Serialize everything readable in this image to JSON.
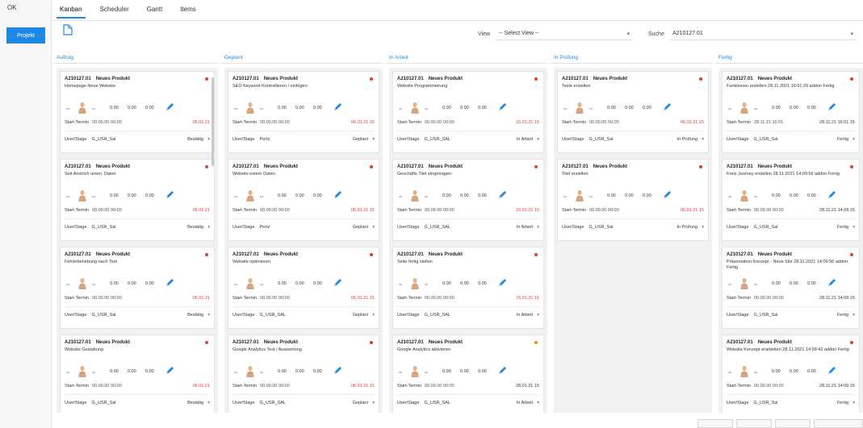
{
  "leftbar": {
    "ok": "OK",
    "project": "Projekt"
  },
  "tabs": [
    {
      "label": "Kanban",
      "active": true
    },
    {
      "label": "Scheduler",
      "active": false
    },
    {
      "label": "Gantt",
      "active": false
    },
    {
      "label": "Items",
      "active": false
    }
  ],
  "toolbar": {
    "view_label": "View",
    "view_value": "-- Select View --",
    "search_label": "Suche",
    "search_value": "A210127.01"
  },
  "columns": [
    {
      "title": "Auftrag",
      "cards": [
        {
          "id": "A210127.01",
          "type": "Neues Produkt",
          "title": "Homepage Neue Website",
          "icon1": "rate",
          "icon2": "time",
          "v1": "0.00",
          "v2": "0.00",
          "v3": "0.00",
          "start_label": "Start-Termin",
          "start": "00.00.00 00:00",
          "due": "06.01.21",
          "user_label": "User/Stage",
          "user": "G_USR_Sal",
          "stage": "Bestätig"
        },
        {
          "id": "A210127.01",
          "type": "Neues Produkt",
          "title": "Seit Anstrich unten, Daten",
          "icon1": "rate",
          "icon2": "time",
          "v1": "0.00",
          "v2": "0.00",
          "v3": "0.00",
          "start_label": "Start-Termin",
          "start": "00.00.00 00:00",
          "due": "06.01.21",
          "user_label": "User/Stage",
          "user": "G_USR_Sal",
          "stage": "Bestätig"
        },
        {
          "id": "A210127.01",
          "type": "Neues Produkt",
          "title": "Fehlerbehebung nach Test",
          "icon1": "rate",
          "icon2": "time",
          "v1": "0.00",
          "v2": "0.00",
          "v3": "0.00",
          "start_label": "Start-Termin",
          "start": "00.00.00 00:00",
          "due": "06.01.21",
          "user_label": "User/Stage",
          "user": "G_USR_Sal",
          "stage": "Bestätig"
        },
        {
          "id": "A210127.01",
          "type": "Neues Produkt",
          "title": "Website Gestaltung",
          "icon1": "rate",
          "icon2": "time",
          "v1": "0.00",
          "v2": "0.00",
          "v3": "0.00",
          "start_label": "Start-Termin",
          "start": "00.00.00 00:00",
          "due": "06.01.21",
          "user_label": "User/Stage",
          "user": "G_USR_Sal",
          "stage": "Bestätig"
        }
      ]
    },
    {
      "title": "Geplant",
      "cards": [
        {
          "id": "A210127.01",
          "type": "Neues Produkt",
          "title": "SEO Keyword Kontrollieren / einfügen",
          "icon1": "rate",
          "icon2": "time",
          "v1": "0.00",
          "v2": "0.00",
          "v3": "0.00",
          "start_label": "Start-Termin",
          "start": "00.00.00 00:00",
          "due": "06.01.21 15",
          "user_label": "User/Stage",
          "user": "Pertz",
          "stage": "Geplant"
        },
        {
          "id": "A210127.01",
          "type": "Neues Produkt",
          "title": "Website extern Daten",
          "icon1": "rate",
          "icon2": "time",
          "v1": "0.00",
          "v2": "0.00",
          "v3": "0.00",
          "start_label": "Start-Termin",
          "start": "00.00.00 00:00",
          "due": "06.01.21 15",
          "user_label": "User/Stage",
          "user": "Pertz",
          "stage": "Geplant"
        },
        {
          "id": "A210127.01",
          "type": "Neues Produkt",
          "title": "Website optimieren",
          "icon1": "rate",
          "icon2": "time",
          "v1": "0.00",
          "v2": "0.00",
          "v3": "0.00",
          "start_label": "Start-Termin",
          "start": "00.00.00 00:00",
          "due": "06.01.21 15",
          "user_label": "User/Stage",
          "user": "G_USR_SAL",
          "stage": "Geplant"
        },
        {
          "id": "A210127.01",
          "type": "Neues Produkt",
          "title": "Google Analytics Test / Auswertung",
          "icon1": "rate",
          "icon2": "time",
          "v1": "0.00",
          "v2": "0.00",
          "v3": "0.00",
          "start_label": "Start-Termin",
          "start": "00.00.00 00:00",
          "due": "06.01.21 15",
          "user_label": "User/Stage",
          "user": "G_USR_SAL",
          "stage": "Geplant"
        }
      ]
    },
    {
      "title": "In Arbeit",
      "cards": [
        {
          "id": "A210127.01",
          "type": "Neues Produkt",
          "title": "Website Programmierung",
          "icon1": "rate",
          "icon2": "time",
          "v1": "0.00",
          "v2": "0.00",
          "v3": "0.00",
          "start_label": "Start-Termin",
          "start": "00.00.00 00:00",
          "due": "15.01.21 15",
          "user_label": "User/Stage",
          "user": "G_USR_SAL",
          "stage": "In Arbeit"
        },
        {
          "id": "A210127.01",
          "type": "Neues Produkt",
          "title": "Geschäfts Titel eingetragen",
          "icon1": "rate",
          "icon2": "time",
          "v1": "0.00",
          "v2": "0.00",
          "v3": "0.00",
          "start_label": "Start-Termin",
          "start": "00.00.00 00:00",
          "due": "15.01.21 15",
          "user_label": "User/Stage",
          "user": "G_USR_SAL",
          "stage": "In Arbeit"
        },
        {
          "id": "A210127.01",
          "type": "Neues Produkt",
          "title": "Seite fertig stellen",
          "icon1": "rate",
          "icon2": "time",
          "v1": "0.00",
          "v2": "0.00",
          "v3": "0.00",
          "start_label": "Start-Termin",
          "start": "00.00.00 00:00",
          "due": "15.01.21 15",
          "user_label": "User/Stage",
          "user": "G_USR_SAL",
          "stage": "In Arbeit"
        },
        {
          "id": "A210127.01",
          "type": "Neues Produkt",
          "title": "Google Analytics aktivieren",
          "icon1": "rate",
          "icon2": "time",
          "v1": "0.00",
          "v2": "0.00",
          "v3": "0.00",
          "start_label": "Start-Termin",
          "start": "00.00.00 00:00",
          "due": "28.01.21 15",
          "due_black": true,
          "dot": "orange",
          "user_label": "User/Stage",
          "user": "G_USR_SAL",
          "stage": "In Arbeit"
        }
      ]
    },
    {
      "title": "In Prüfung",
      "cards": [
        {
          "id": "A210127.01",
          "type": "Neues Produkt",
          "title": "Texte erstellen",
          "icon1": "rate",
          "icon2": "time",
          "v1": "0.00",
          "v2": "0.00",
          "v3": "0.00",
          "start_label": "Start-Termin",
          "start": "00.00.00 00:00",
          "due": "06.01.21 15",
          "user_label": "User/Stage",
          "user": "G_USR_Sal",
          "stage": "In Prüfung"
        },
        {
          "id": "A210127.01",
          "type": "Neues Produkt",
          "title": "Titel erstellen",
          "icon1": "rate",
          "icon2": "time",
          "v1": "0.00",
          "v2": "0.00",
          "v3": "0.00",
          "start_label": "Start-Termin",
          "start": "00.00.00 00:00",
          "due": "06.01.21 15",
          "user_label": "User/Stage",
          "user": "G_USR_Sal",
          "stage": "In Prüfung"
        }
      ]
    },
    {
      "title": "Fertig",
      "cards": [
        {
          "id": "A210127.01",
          "type": "Neues Produkt",
          "title": "Funktionen erstellen 28.11.2021 16:01:29 addon Fertig",
          "icon1": "rate",
          "icon2": "time",
          "v1": "0.00",
          "v2": "0.00",
          "v3": "0.00",
          "start_label": "Start-Termin",
          "start": "28.11.21 16:01",
          "due": "28.11.21 16:01 15",
          "due_black": true,
          "user_label": "User/Stage",
          "user": "G_USR_Sal",
          "stage": "Fertig"
        },
        {
          "id": "A210127.01",
          "type": "Neues Produkt",
          "title": "Kreis Journey erstellen 28.11.2021 14:09:56 addon Fertig",
          "icon1": "rate",
          "icon2": "time",
          "v1": "0.00",
          "v2": "0.00",
          "v3": "0.00",
          "start_label": "Start-Termin",
          "start": "00.00.00 00:00",
          "due": "28.11.21 14:09 15",
          "due_black": true,
          "user_label": "User/Stage",
          "user": "G_USR_Sal",
          "stage": "Fertig"
        },
        {
          "id": "A210127.01",
          "type": "Neues Produkt",
          "title": "Präsentation Konzept - Neue Site 28.11.2021 14:09:56 addon Fertig",
          "icon1": "rate",
          "icon2": "time",
          "v1": "0.00",
          "v2": "0.00",
          "v3": "0.00",
          "start_label": "Start-Termin",
          "start": "00.00.00 00:00",
          "due": "28.11.21 14:09 15",
          "due_black": true,
          "user_label": "User/Stage",
          "user": "G_USR_Sal",
          "stage": "Fertig"
        },
        {
          "id": "A210127.01",
          "type": "Neues Produkt",
          "title": "Website Konzept erarbeiten 28.11.2021 14:09:42 addon Fertig",
          "icon1": "rate",
          "icon2": "time",
          "v1": "0.00",
          "v2": "0.00",
          "v3": "0.00",
          "start_label": "Start-Termin",
          "start": "00.00.00 00:00",
          "due": "28.11.21 14:09 15",
          "due_black": true,
          "user_label": "User/Stage",
          "user": "G_USR_Sal",
          "stage": "Fertig"
        }
      ]
    }
  ],
  "colors": {
    "accent": "#1e88e5",
    "alert": "#e53935",
    "warn": "#fb8c00"
  }
}
